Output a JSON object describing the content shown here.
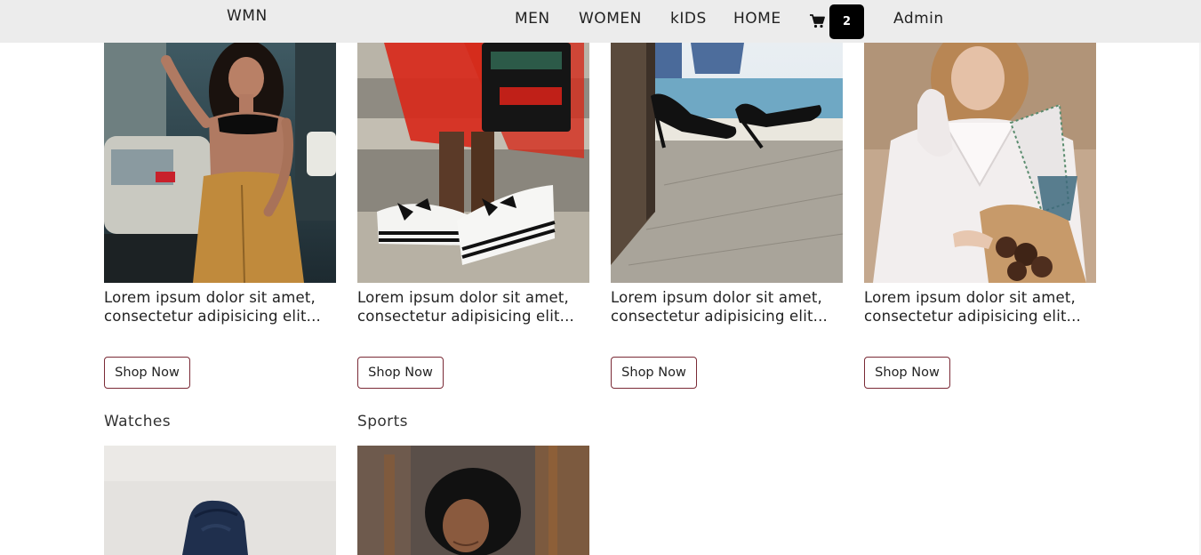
{
  "navbar": {
    "brand": "WMN",
    "links": [
      "MEN",
      "WOMEN",
      "kIDS",
      "HOME"
    ],
    "cart_icon": "shopping-cart-icon",
    "cart_count": "2",
    "user": "Admin"
  },
  "products": [
    {
      "line1": "Lorem ipsum dolor sit amet,",
      "line2": "consectetur adipisicing elit...",
      "button": "Shop Now"
    },
    {
      "line1": "Lorem ipsum dolor sit amet,",
      "line2": "consectetur adipisicing elit...",
      "button": "Shop Now"
    },
    {
      "line1": "Lorem ipsum dolor sit amet,",
      "line2": "consectetur adipisicing elit...",
      "button": "Shop Now"
    },
    {
      "line1": "Lorem ipsum dolor sit amet,",
      "line2": "consectetur adipisicing elit...",
      "button": "Shop Now"
    }
  ],
  "sections": [
    {
      "title": "Watches"
    },
    {
      "title": "Sports"
    }
  ]
}
